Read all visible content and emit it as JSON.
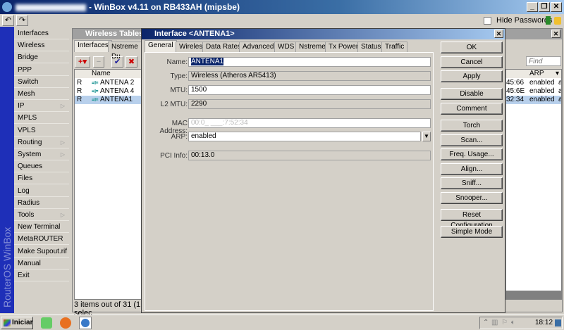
{
  "window": {
    "title": "- WinBox v4.11 on RB433AH (mipsbe)",
    "hide_passwords": "Hide Passwords",
    "brand": "RouterOS WinBox"
  },
  "menu": [
    "Interfaces",
    "Wireless",
    "Bridge",
    "PPP",
    "Switch",
    "Mesh",
    "IP",
    "MPLS",
    "VPLS",
    "Routing",
    "System",
    "Queues",
    "Files",
    "Log",
    "Radius",
    "Tools",
    "New Terminal",
    "MetaROUTER",
    "Make Supout.rif",
    "Manual",
    "Exit"
  ],
  "menu_submenu": [
    "IP",
    "Routing",
    "System",
    "Tools"
  ],
  "wireless_tables": {
    "title": "Wireless Tables",
    "tabs": [
      "Interfaces",
      "Nstreme Du"
    ],
    "find_placeholder": "Find",
    "col_name": "Name",
    "col_arp": "ARP",
    "rows": [
      {
        "flag": "R",
        "name": "ANTENA 2",
        "mac": "45:66",
        "arp": "enabled",
        "extra": "a"
      },
      {
        "flag": "R",
        "name": "ANTENA 4",
        "mac": "45:6E",
        "arp": "enabled",
        "extra": "a"
      },
      {
        "flag": "R",
        "name": "ANTENA1",
        "mac": "32:34",
        "arp": "enabled",
        "extra": "a"
      }
    ],
    "status": "3 items out of 31 (1 selec"
  },
  "dialog": {
    "title": "Interface <ANTENA1>",
    "tabs": [
      "General",
      "Wireless",
      "Data Rates",
      "Advanced",
      "WDS",
      "Nstreme",
      "Tx Power",
      "Status",
      "Traffic"
    ],
    "fields": {
      "name_label": "Name:",
      "name": "ANTENA1",
      "type_label": "Type:",
      "type": "Wireless (Atheros AR5413)",
      "mtu_label": "MTU:",
      "mtu": "1500",
      "l2mtu_label": "L2 MTU:",
      "l2mtu": "2290",
      "mac_label": "MAC Address:",
      "mac": "00:0_ ___:7:52:34",
      "arp_label": "ARP:",
      "arp": "enabled",
      "pci_label": "PCI Info:",
      "pci": "00:13.0"
    },
    "buttons": [
      "OK",
      "Cancel",
      "Apply",
      "Disable",
      "Comment",
      "Torch",
      "Scan...",
      "Freq. Usage...",
      "Align...",
      "Sniff...",
      "Snooper...",
      "Reset Configuration",
      "Simple Mode"
    ]
  },
  "taskbar": {
    "start": "Iniciar",
    "clock": "18:12"
  }
}
